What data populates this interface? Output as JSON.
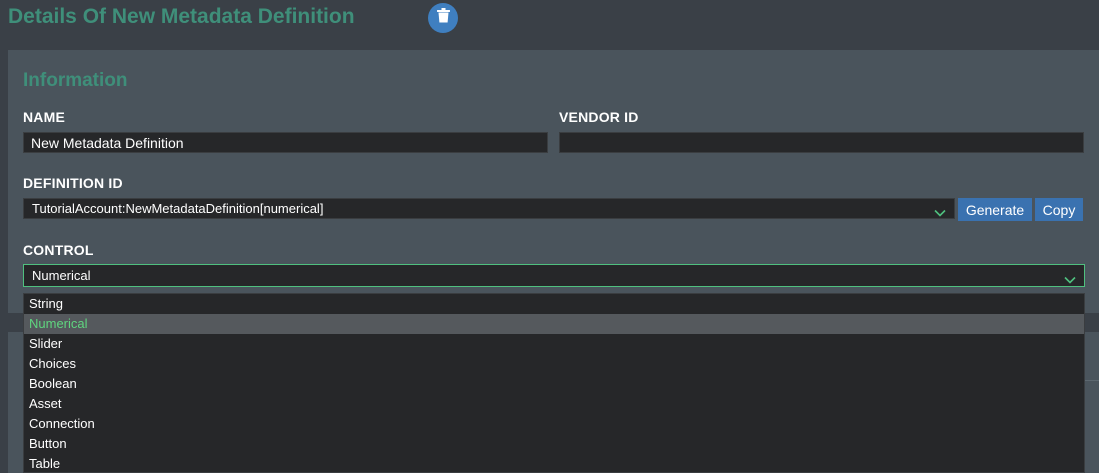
{
  "header": {
    "title": "Details Of New Metadata Definition"
  },
  "information": {
    "section_title": "Information",
    "name": {
      "label": "NAME",
      "value": "New Metadata Definition"
    },
    "vendor_id": {
      "label": "VENDOR ID",
      "value": ""
    },
    "definition_id": {
      "label": "DEFINITION ID",
      "value": "TutorialAccount:NewMetadataDefinition[numerical]",
      "generate_label": "Generate",
      "copy_label": "Copy"
    },
    "control": {
      "label": "CONTROL",
      "selected": "Numerical",
      "options": [
        "String",
        "Numerical",
        "Slider",
        "Choices",
        "Boolean",
        "Asset",
        "Connection",
        "Button",
        "Table"
      ]
    }
  },
  "colors": {
    "accent_green": "#3f8f7a",
    "selected_text": "#5fd67f",
    "button_blue": "#3a72b0",
    "delete_blue": "#3f7fc0"
  },
  "icons": {
    "delete": "trash-icon",
    "dropdown": "chevron-down-icon"
  }
}
